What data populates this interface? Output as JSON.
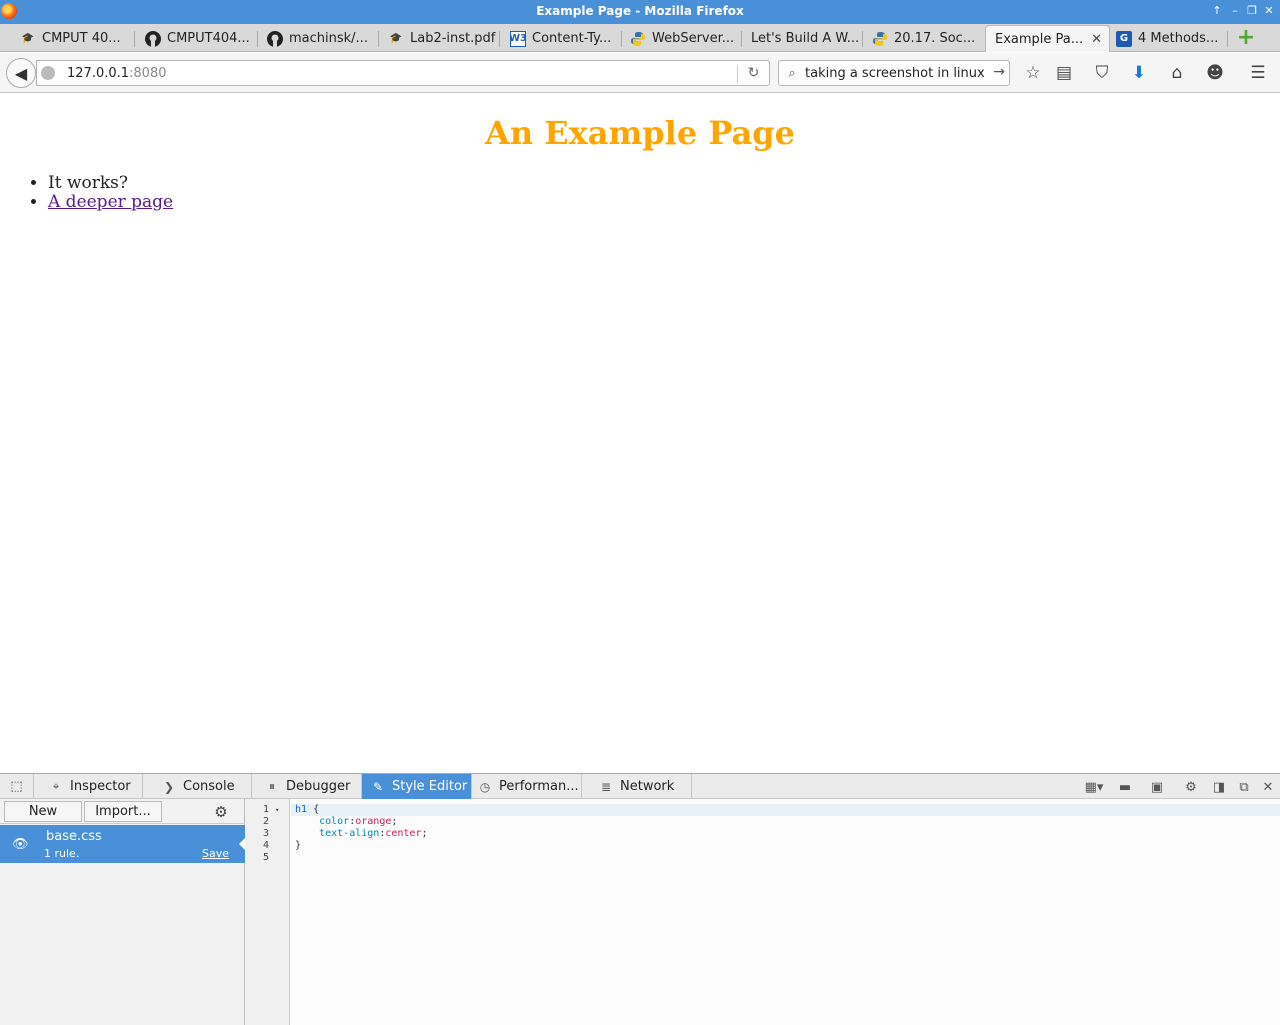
{
  "window": {
    "title": "Example Page - Mozilla Firefox"
  },
  "tabs": [
    {
      "label": "CMPUT 40...",
      "icon": "moodle-icon"
    },
    {
      "label": "CMPUT404...",
      "icon": "github-icon"
    },
    {
      "label": "machinsk/...",
      "icon": "github-icon"
    },
    {
      "label": "Lab2-inst.pdf",
      "icon": "moodle-icon"
    },
    {
      "label": "Content-Ty...",
      "icon": "w3-icon"
    },
    {
      "label": "WebServer...",
      "icon": "python-icon"
    },
    {
      "label": "Let's Build A W...",
      "icon": ""
    },
    {
      "label": "20.17. Soc...",
      "icon": "python-icon"
    },
    {
      "label": "Example Pa...",
      "icon": "",
      "active": true
    },
    {
      "label": "4 Methods...",
      "icon": "site-icon"
    }
  ],
  "navbar": {
    "url_host": "127.0.0.1",
    "url_port": ":8080",
    "search_value": "taking a screenshot in linux"
  },
  "page": {
    "heading": "An Example Page",
    "items": [
      "It works?",
      "A deeper page"
    ],
    "heading_color": "#ffa500",
    "link_color": "#551a8b"
  },
  "devtools": {
    "tabs": [
      "Inspector",
      "Console",
      "Debugger",
      "Style Editor",
      "Performan...",
      "Network"
    ],
    "active_tab": "Style Editor",
    "side": {
      "new_label": "New",
      "import_label": "Import...",
      "sheet_name": "base.css",
      "sheet_rules": "1 rule.",
      "save_label": "Save"
    },
    "line_numbers": [
      "1",
      "2",
      "3",
      "4",
      "5"
    ],
    "code": {
      "selector": "h1",
      "open_brace": " {",
      "prop1": "color",
      "val1": "orange",
      "prop2": "text-align",
      "val2": "center",
      "close_brace": "}"
    }
  },
  "colors": {
    "accent": "#4a90d9"
  }
}
